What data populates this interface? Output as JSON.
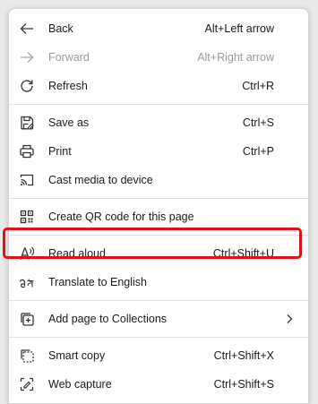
{
  "menu": {
    "items": [
      {
        "icon": "back-arrow-icon",
        "label": "Back",
        "shortcut": "Alt+Left arrow",
        "disabled": false
      },
      {
        "icon": "forward-arrow-icon",
        "label": "Forward",
        "shortcut": "Alt+Right arrow",
        "disabled": true
      },
      {
        "icon": "refresh-icon",
        "label": "Refresh",
        "shortcut": "Ctrl+R",
        "disabled": false
      },
      {
        "icon": "save-icon",
        "label": "Save as",
        "shortcut": "Ctrl+S",
        "disabled": false
      },
      {
        "icon": "print-icon",
        "label": "Print",
        "shortcut": "Ctrl+P",
        "disabled": false
      },
      {
        "icon": "cast-icon",
        "label": "Cast media to device",
        "shortcut": "",
        "disabled": false
      },
      {
        "icon": "qr-code-icon",
        "label": "Create QR code for this page",
        "shortcut": "",
        "disabled": false
      },
      {
        "icon": "read-aloud-icon",
        "label": "Read aloud",
        "shortcut": "Ctrl+Shift+U",
        "disabled": false,
        "highlighted": true
      },
      {
        "icon": "translate-icon",
        "label": "Translate to English",
        "shortcut": "",
        "disabled": false
      },
      {
        "icon": "collections-icon",
        "label": "Add page to Collections",
        "shortcut": "",
        "disabled": false,
        "submenu": true
      },
      {
        "icon": "smart-copy-icon",
        "label": "Smart copy",
        "shortcut": "Ctrl+Shift+X",
        "disabled": false
      },
      {
        "icon": "web-capture-icon",
        "label": "Web capture",
        "shortcut": "Ctrl+Shift+S",
        "disabled": false
      }
    ]
  },
  "colors": {
    "highlight_border": "#e1101a",
    "disabled_text": "#9b9b9b",
    "text": "#1a1a1a"
  }
}
